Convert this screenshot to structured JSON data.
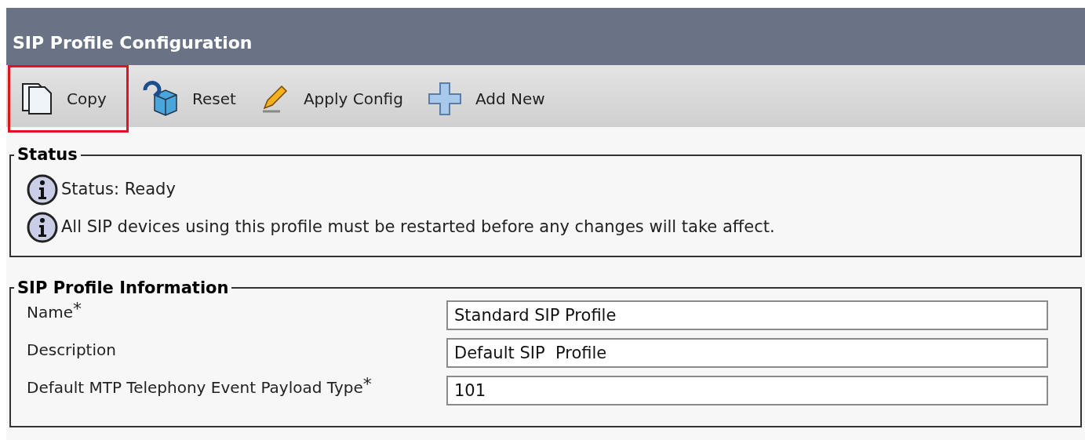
{
  "header": {
    "title": "SIP Profile Configuration"
  },
  "toolbar": [
    {
      "kind": "copy",
      "label": "Copy",
      "highlighted": true
    },
    {
      "kind": "reset",
      "label": "Reset",
      "highlighted": false
    },
    {
      "kind": "apply",
      "label": "Apply Config",
      "highlighted": false
    },
    {
      "kind": "add",
      "label": "Add New",
      "highlighted": false
    }
  ],
  "status": {
    "legend": "Status",
    "messages": [
      "Status: Ready",
      "All SIP devices using this profile must be restarted before any changes will take affect."
    ]
  },
  "info": {
    "legend": "SIP Profile Information",
    "fields": [
      {
        "label": "Name",
        "required_mark": "*",
        "value": "Standard SIP Profile"
      },
      {
        "label": "Description",
        "value": "Default SIP  Profile"
      },
      {
        "label": "Default MTP Telephony Event Payload Type",
        "required_mark": "*",
        "value": "101"
      }
    ]
  }
}
